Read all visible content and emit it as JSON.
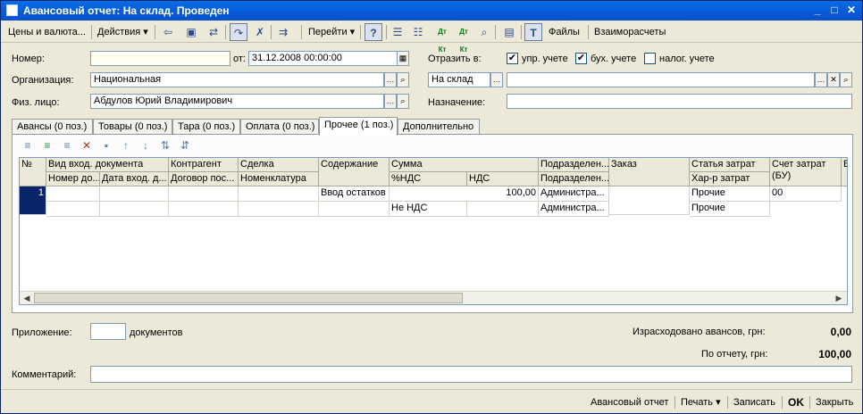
{
  "window": {
    "title": "Авансовый отчет: На склад. Проведен",
    "minimize": "_",
    "maximize": "□",
    "close": "✕"
  },
  "toolbar": {
    "prices_label": "Цены и валюта...",
    "actions_label": "Действия",
    "goto_label": "Перейти",
    "help_label": "?",
    "dt_kt_label": "Дт Кт",
    "dt_kt_n_label": "Дт Кт",
    "files_label": "Файлы",
    "settlements_label": "Взаиморасчеты"
  },
  "header": {
    "number_label": "Номер:",
    "number_value": "",
    "date_label": "от:",
    "date_value": "31.12.2008 00:00:00",
    "reflect_label": "Отразить в:",
    "mgmt_label": "упр. учете",
    "mgmt_checked": true,
    "acct_label": "бух. учете",
    "acct_checked": true,
    "tax_label": "налог. учете",
    "tax_checked": false,
    "org_label": "Организация:",
    "org_value": "Национальная",
    "warehouse_type": "На склад",
    "warehouse_value": "",
    "person_label": "Физ. лицо:",
    "person_value": "Абдулов Юрий Владимирович",
    "purpose_label": "Назначение:",
    "purpose_value": ""
  },
  "tabs": [
    {
      "label": "Авансы (0 поз.)"
    },
    {
      "label": "Товары (0 поз.)"
    },
    {
      "label": "Тара (0 поз.)"
    },
    {
      "label": "Оплата (0 поз.)"
    },
    {
      "label": "Прочее (1 поз.)"
    },
    {
      "label": "Дополнительно"
    }
  ],
  "grid": {
    "headers_top": [
      "№",
      "Вид вход. документа",
      "Контрагент",
      "Сделка",
      "Содержание",
      "Сумма",
      "Подразделен...",
      "Заказ",
      "Статья затрат",
      "Счет затрат (БУ)",
      "В"
    ],
    "headers_bottom": [
      "Номер до...",
      "Дата вход. д...",
      "Договор пос...",
      "Номенклатура",
      "%НДС",
      "НДС",
      "Подразделен...",
      "Хар-р затрат"
    ],
    "rows": [
      {
        "num": "1",
        "content": "Ввод остатков",
        "sum": "100,00",
        "dept": "Администра...",
        "cost_item": "Прочие",
        "account": "00",
        "vat_rate": "Не НДС",
        "dept2": "Администра...",
        "cost_kind": "Прочие"
      }
    ]
  },
  "footer": {
    "attachment_label": "Приложение:",
    "attachment_value": "",
    "docs_label": "документов",
    "spent_label": "Израсходовано авансов, грн:",
    "spent_value": "0,00",
    "report_label": "По отчету, грн:",
    "report_value": "100,00",
    "comment_label": "Комментарий:",
    "comment_value": ""
  },
  "bottombar": {
    "advance_report": "Авансовый отчет",
    "print": "Печать",
    "save": "Записать",
    "ok": "OK",
    "close": "Закрыть"
  }
}
